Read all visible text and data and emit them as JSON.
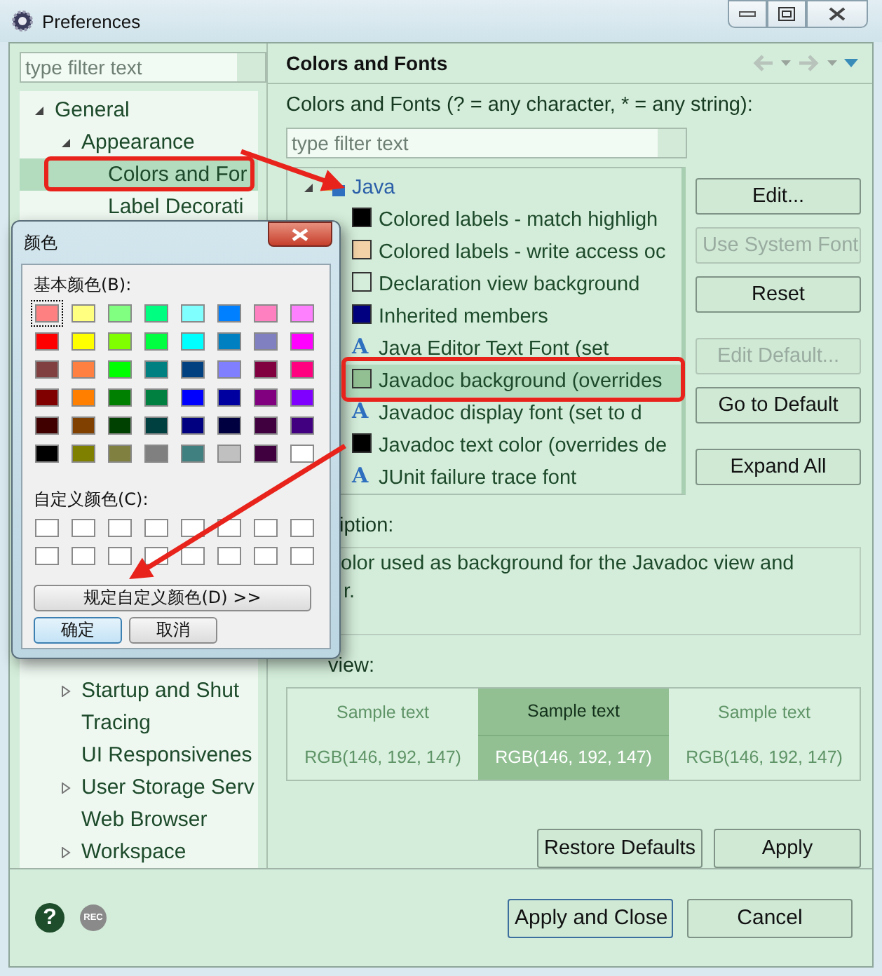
{
  "window": {
    "title": "Preferences"
  },
  "filter": {
    "placeholder": "type filter text"
  },
  "nav_tree": [
    {
      "label": "General",
      "expanded": true,
      "selected": false,
      "children": [
        {
          "label": "Appearance",
          "expanded": true,
          "selected": false,
          "children": [
            {
              "label": "Colors and For",
              "selected": true
            },
            {
              "label": "Label Decorati",
              "selected": false
            }
          ]
        },
        {
          "label": "Startup and Shut",
          "expanded": false,
          "selected": false
        },
        {
          "label": "Tracing",
          "selected": false
        },
        {
          "label": "UI Responsivenes",
          "selected": false
        },
        {
          "label": "User Storage Serv",
          "expanded": false,
          "selected": false
        },
        {
          "label": "Web Browser",
          "selected": false
        },
        {
          "label": "Workspace",
          "expanded": false,
          "selected": false
        }
      ]
    }
  ],
  "page": {
    "title": "Colors and Fonts",
    "filter_label": "Colors and Fonts (? = any character, * = any string):",
    "filter": {
      "placeholder": "type filter text"
    },
    "tree": [
      {
        "label": "Java",
        "expanded": true,
        "children": [
          {
            "kind": "color",
            "color": "#000000",
            "label": "Colored labels - match highligh",
            "selected": false
          },
          {
            "kind": "color",
            "color": "#f2d2a6",
            "label": "Colored labels - write access oc",
            "selected": false
          },
          {
            "kind": "color",
            "color": "#d5eedb",
            "label": "Declaration view background",
            "selected": false
          },
          {
            "kind": "color",
            "color": "#000080",
            "label": "Inherited members",
            "selected": false
          },
          {
            "kind": "font",
            "icon": "A",
            "label": "Java Editor Text Font (set",
            "selected": false
          },
          {
            "kind": "color",
            "color": "#92c093",
            "label": "Javadoc background (overrides",
            "selected": true
          },
          {
            "kind": "font",
            "icon": "A",
            "label": "Javadoc display font (set to d",
            "selected": false
          },
          {
            "kind": "color",
            "color": "#000000",
            "label": "Javadoc text color (overrides de",
            "selected": false
          },
          {
            "kind": "font",
            "icon": "A",
            "label": "JUnit failure trace font",
            "selected": false
          }
        ]
      }
    ],
    "buttons": [
      {
        "label": "Edit...",
        "disabled": false
      },
      {
        "label": "Use System Font",
        "disabled": true
      },
      {
        "label": "Reset",
        "disabled": false
      },
      {
        "label": "Edit Default...",
        "disabled": true
      },
      {
        "label": "Go to Default",
        "disabled": false
      },
      {
        "label": "Expand All",
        "disabled": false
      }
    ],
    "description_label": "iption:",
    "description_lines": [
      "olor used as background for the Javadoc view and",
      "r."
    ],
    "preview_label": "view:",
    "preview": [
      {
        "sample": "Sample text",
        "rgb": "RGB(146, 192, 147)",
        "selected": false
      },
      {
        "sample": "Sample text",
        "rgb": "RGB(146, 192, 147)",
        "selected": true
      },
      {
        "sample": "Sample text",
        "rgb": "RGB(146, 192, 147)",
        "selected": false
      }
    ],
    "actions": [
      "Restore Defaults",
      "Apply"
    ]
  },
  "footer": {
    "help": "?",
    "record": "REC",
    "buttons": [
      {
        "label": "Apply and Close",
        "default": true
      },
      {
        "label": "Cancel",
        "default": false
      }
    ]
  },
  "color_dialog": {
    "title": "颜色",
    "basic_label": "基本颜色(B):",
    "basic_colors": [
      [
        {
          "color": "#ff8080",
          "selected": true
        },
        {
          "color": "#ffff80",
          "selected": false
        },
        {
          "color": "#80ff80",
          "selected": false
        },
        {
          "color": "#00ff80",
          "selected": false
        },
        {
          "color": "#80ffff",
          "selected": false
        },
        {
          "color": "#0080ff",
          "selected": false
        },
        {
          "color": "#ff80c0",
          "selected": false
        },
        {
          "color": "#ff80ff",
          "selected": false
        }
      ],
      [
        {
          "color": "#ff0000",
          "selected": false
        },
        {
          "color": "#ffff00",
          "selected": false
        },
        {
          "color": "#80ff00",
          "selected": false
        },
        {
          "color": "#00ff40",
          "selected": false
        },
        {
          "color": "#00ffff",
          "selected": false
        },
        {
          "color": "#0080c0",
          "selected": false
        },
        {
          "color": "#8080c0",
          "selected": false
        },
        {
          "color": "#ff00ff",
          "selected": false
        }
      ],
      [
        {
          "color": "#804040",
          "selected": false
        },
        {
          "color": "#ff8040",
          "selected": false
        },
        {
          "color": "#00ff00",
          "selected": false
        },
        {
          "color": "#008080",
          "selected": false
        },
        {
          "color": "#004080",
          "selected": false
        },
        {
          "color": "#8080ff",
          "selected": false
        },
        {
          "color": "#800040",
          "selected": false
        },
        {
          "color": "#ff0080",
          "selected": false
        }
      ],
      [
        {
          "color": "#800000",
          "selected": false
        },
        {
          "color": "#ff8000",
          "selected": false
        },
        {
          "color": "#008000",
          "selected": false
        },
        {
          "color": "#008040",
          "selected": false
        },
        {
          "color": "#0000ff",
          "selected": false
        },
        {
          "color": "#0000a0",
          "selected": false
        },
        {
          "color": "#800080",
          "selected": false
        },
        {
          "color": "#8000ff",
          "selected": false
        }
      ],
      [
        {
          "color": "#400000",
          "selected": false
        },
        {
          "color": "#804000",
          "selected": false
        },
        {
          "color": "#004000",
          "selected": false
        },
        {
          "color": "#004040",
          "selected": false
        },
        {
          "color": "#000080",
          "selected": false
        },
        {
          "color": "#000040",
          "selected": false
        },
        {
          "color": "#400040",
          "selected": false
        },
        {
          "color": "#400080",
          "selected": false
        }
      ],
      [
        {
          "color": "#000000",
          "selected": false
        },
        {
          "color": "#808000",
          "selected": false
        },
        {
          "color": "#808040",
          "selected": false
        },
        {
          "color": "#808080",
          "selected": false
        },
        {
          "color": "#408080",
          "selected": false
        },
        {
          "color": "#c0c0c0",
          "selected": false
        },
        {
          "color": "#400040",
          "selected": false
        },
        {
          "color": "#ffffff",
          "selected": false
        }
      ]
    ],
    "custom_label": "自定义颜色(C):",
    "custom_colors": [
      [
        {
          "color": "#ffffff"
        },
        {
          "color": "#ffffff"
        },
        {
          "color": "#ffffff"
        },
        {
          "color": "#ffffff"
        },
        {
          "color": "#ffffff"
        },
        {
          "color": "#ffffff"
        },
        {
          "color": "#ffffff"
        },
        {
          "color": "#ffffff"
        }
      ],
      [
        {
          "color": "#ffffff"
        },
        {
          "color": "#ffffff"
        },
        {
          "color": "#ffffff"
        },
        {
          "color": "#ffffff"
        },
        {
          "color": "#ffffff"
        },
        {
          "color": "#ffffff"
        },
        {
          "color": "#ffffff"
        },
        {
          "color": "#ffffff"
        }
      ]
    ],
    "define_button": "规定自定义颜色(D) >>",
    "ok": "确定",
    "cancel": "取消"
  }
}
